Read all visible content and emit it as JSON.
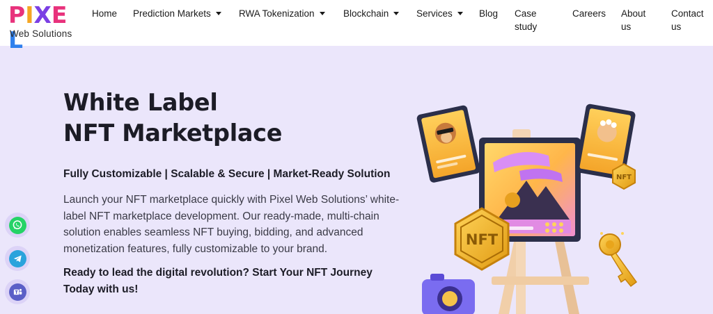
{
  "brand": {
    "logo_letters": [
      "P",
      "I",
      "X",
      "E",
      "L"
    ],
    "logo_colors": [
      "#e8327c",
      "#f5a623",
      "#7b3fe4",
      "#e8327c",
      "#2f80ed"
    ],
    "tagline": "Web Solutions"
  },
  "nav": {
    "items": [
      {
        "label": "Home"
      },
      {
        "label": "Prediction Markets"
      },
      {
        "label": "RWA Tokenization"
      },
      {
        "label": "Blockchain"
      },
      {
        "label": "Services"
      },
      {
        "label": "Blog"
      },
      {
        "label": "Case\nstudy"
      },
      {
        "label": "Careers"
      },
      {
        "label": "About\nus"
      },
      {
        "label": "Contact\nus"
      }
    ]
  },
  "hero": {
    "title_line1": "White Label",
    "title_line2": "NFT Marketplace",
    "tagline": "Fully Customizable | Scalable & Secure | Market-Ready Solution",
    "description": "Launch your NFT marketplace quickly with Pixel Web Solutions’ white-label NFT marketplace development. Our ready-made, multi-chain solution enables seamless NFT buying, bidding, and advanced monetization features, fully customizable to your brand.",
    "cta": "Ready to lead the digital revolution? Start Your NFT Journey Today with us!"
  },
  "illustration": {
    "badge_large": "NFT",
    "badge_small": "NFT"
  },
  "social": {
    "icons": [
      "whatsapp-icon",
      "telegram-icon",
      "teams-icon"
    ]
  },
  "colors": {
    "background": "#ebe6fb",
    "whatsapp": "#25d366",
    "telegram": "#2aa3dc",
    "teams": "#5b5fc7",
    "gold": "#f6b81f"
  }
}
